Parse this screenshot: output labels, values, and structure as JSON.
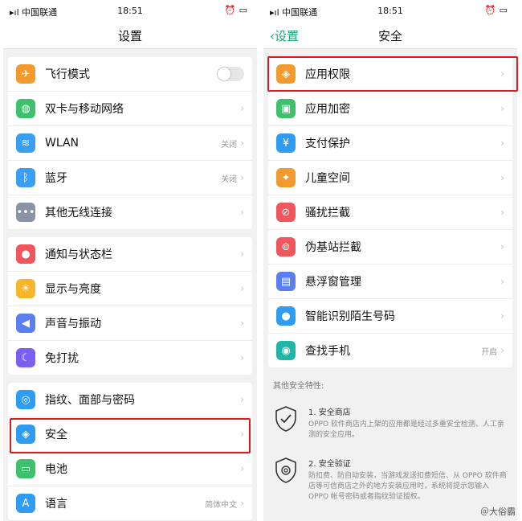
{
  "status": {
    "carrier": "中国联通",
    "time": "18:51"
  },
  "left": {
    "title": "设置",
    "groups": [
      [
        {
          "label": "飞行模式",
          "icon": "airplane-icon",
          "color": "#f39a2e",
          "toggle": true
        },
        {
          "label": "双卡与移动网络",
          "icon": "globe-icon",
          "color": "#3fc06c"
        },
        {
          "label": "WLAN",
          "icon": "wifi-icon",
          "color": "#3a9ff2",
          "value": "关闭"
        },
        {
          "label": "蓝牙",
          "icon": "bluetooth-icon",
          "color": "#3a9ff2",
          "value": "关闭"
        },
        {
          "label": "其他无线连接",
          "icon": "more-icon",
          "color": "#8a93a3"
        }
      ],
      [
        {
          "label": "通知与状态栏",
          "icon": "bell-icon",
          "color": "#f0565b"
        },
        {
          "label": "显示与亮度",
          "icon": "sun-icon",
          "color": "#f6b52b"
        },
        {
          "label": "声音与振动",
          "icon": "speaker-icon",
          "color": "#5b7ef0"
        },
        {
          "label": "免打扰",
          "icon": "moon-icon",
          "color": "#7b5ff0"
        }
      ],
      [
        {
          "label": "指纹、面部与密码",
          "icon": "fingerprint-icon",
          "color": "#2e9cf2"
        },
        {
          "label": "安全",
          "icon": "shield-icon",
          "color": "#2e9cf2"
        },
        {
          "label": "电池",
          "icon": "battery-icon",
          "color": "#3fc06c"
        },
        {
          "label": "语言",
          "icon": "language-icon",
          "color": "#2e9cf2",
          "value": "简体中文"
        }
      ]
    ]
  },
  "right": {
    "back": "设置",
    "title": "安全",
    "items": [
      {
        "label": "应用权限",
        "icon": "shield-key-icon",
        "color": "#f39a2e"
      },
      {
        "label": "应用加密",
        "icon": "lock-icon",
        "color": "#3fc06c"
      },
      {
        "label": "支付保护",
        "icon": "payment-shield-icon",
        "color": "#2e9cf2"
      },
      {
        "label": "儿童空间",
        "icon": "child-icon",
        "color": "#f39a2e"
      },
      {
        "label": "骚扰拦截",
        "icon": "block-icon",
        "color": "#f0565b"
      },
      {
        "label": "伪基站拦截",
        "icon": "signal-tower-icon",
        "color": "#f0565b"
      },
      {
        "label": "悬浮窗管理",
        "icon": "floating-window-icon",
        "color": "#5b7ef0"
      },
      {
        "label": "智能识别陌生号码",
        "icon": "contact-icon",
        "color": "#2e9cf2"
      },
      {
        "label": "查找手机",
        "icon": "find-phone-icon",
        "color": "#1fb6a8",
        "value": "开启"
      }
    ],
    "notes_header": "其他安全特性:",
    "notes": [
      {
        "title": "1. 安全商店",
        "text": "OPPO 软件商店内上架的应用都是经过多重安全检测、人工亲测的安全应用。",
        "icon": "shield-check-icon"
      },
      {
        "title": "2. 安全验证",
        "text": "防扣费、防自动安装，当游戏发送扣费短信、从 OPPO 软件商店等可信商店之外的地方安装应用时，系统将提示您输入 OPPO 帐号密码或者指纹验证授权。",
        "icon": "fingerprint-badge-icon"
      }
    ]
  },
  "watermark": "＠大俗霸"
}
